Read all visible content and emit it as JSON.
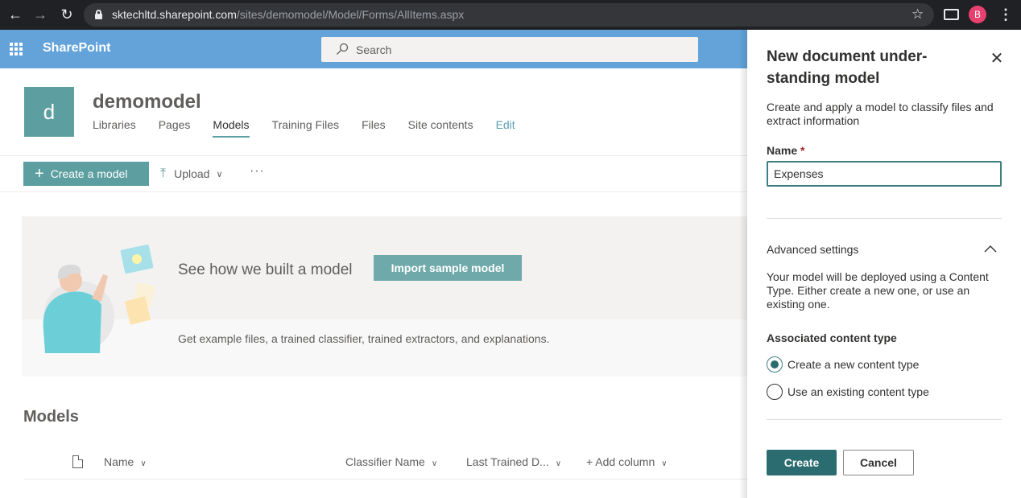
{
  "browser": {
    "url_host": "sktechltd.sharepoint.com",
    "url_path": "/sites/demomodel/Model/Forms/AllItems.aspx",
    "profile_initial": "B"
  },
  "suite_bar": {
    "brand": "SharePoint",
    "search_placeholder": "Search",
    "color": "#63a3da"
  },
  "site": {
    "logo_letter": "d",
    "title": "demomodel",
    "nav": [
      "Libraries",
      "Pages",
      "Models",
      "Training Files",
      "Files",
      "Site contents",
      "Edit"
    ],
    "active_nav": "Models",
    "accent": "#5d9ea0"
  },
  "command_bar": {
    "create_label": "Create a model",
    "upload_label": "Upload",
    "more_label": "···"
  },
  "banner": {
    "title": "See how we built a model",
    "button_label": "Import sample model",
    "description": "Get example files, a trained classifier, trained extractors, and explanations."
  },
  "models": {
    "heading": "Models",
    "columns": [
      "Name",
      "Classifier Name",
      "Last Trained D...",
      "+ Add column"
    ]
  },
  "panel": {
    "title": "New document under-standing model",
    "close_icon": "close-icon",
    "description": "Create and apply a model to classify files and extract information",
    "name_label": "Name",
    "required_mark": "*",
    "name_value": "Expenses",
    "advanced_label": "Advanced settings",
    "advanced_description": "Your model will be deployed using a Content Type. Either create a new one, or use an existing one.",
    "associated_label": "Associated content type",
    "options": [
      {
        "label": "Create a new content type",
        "selected": true
      },
      {
        "label": "Use an existing content type",
        "selected": false
      }
    ],
    "create_label": "Create",
    "cancel_label": "Cancel",
    "primary_color": "#2b6c70"
  }
}
